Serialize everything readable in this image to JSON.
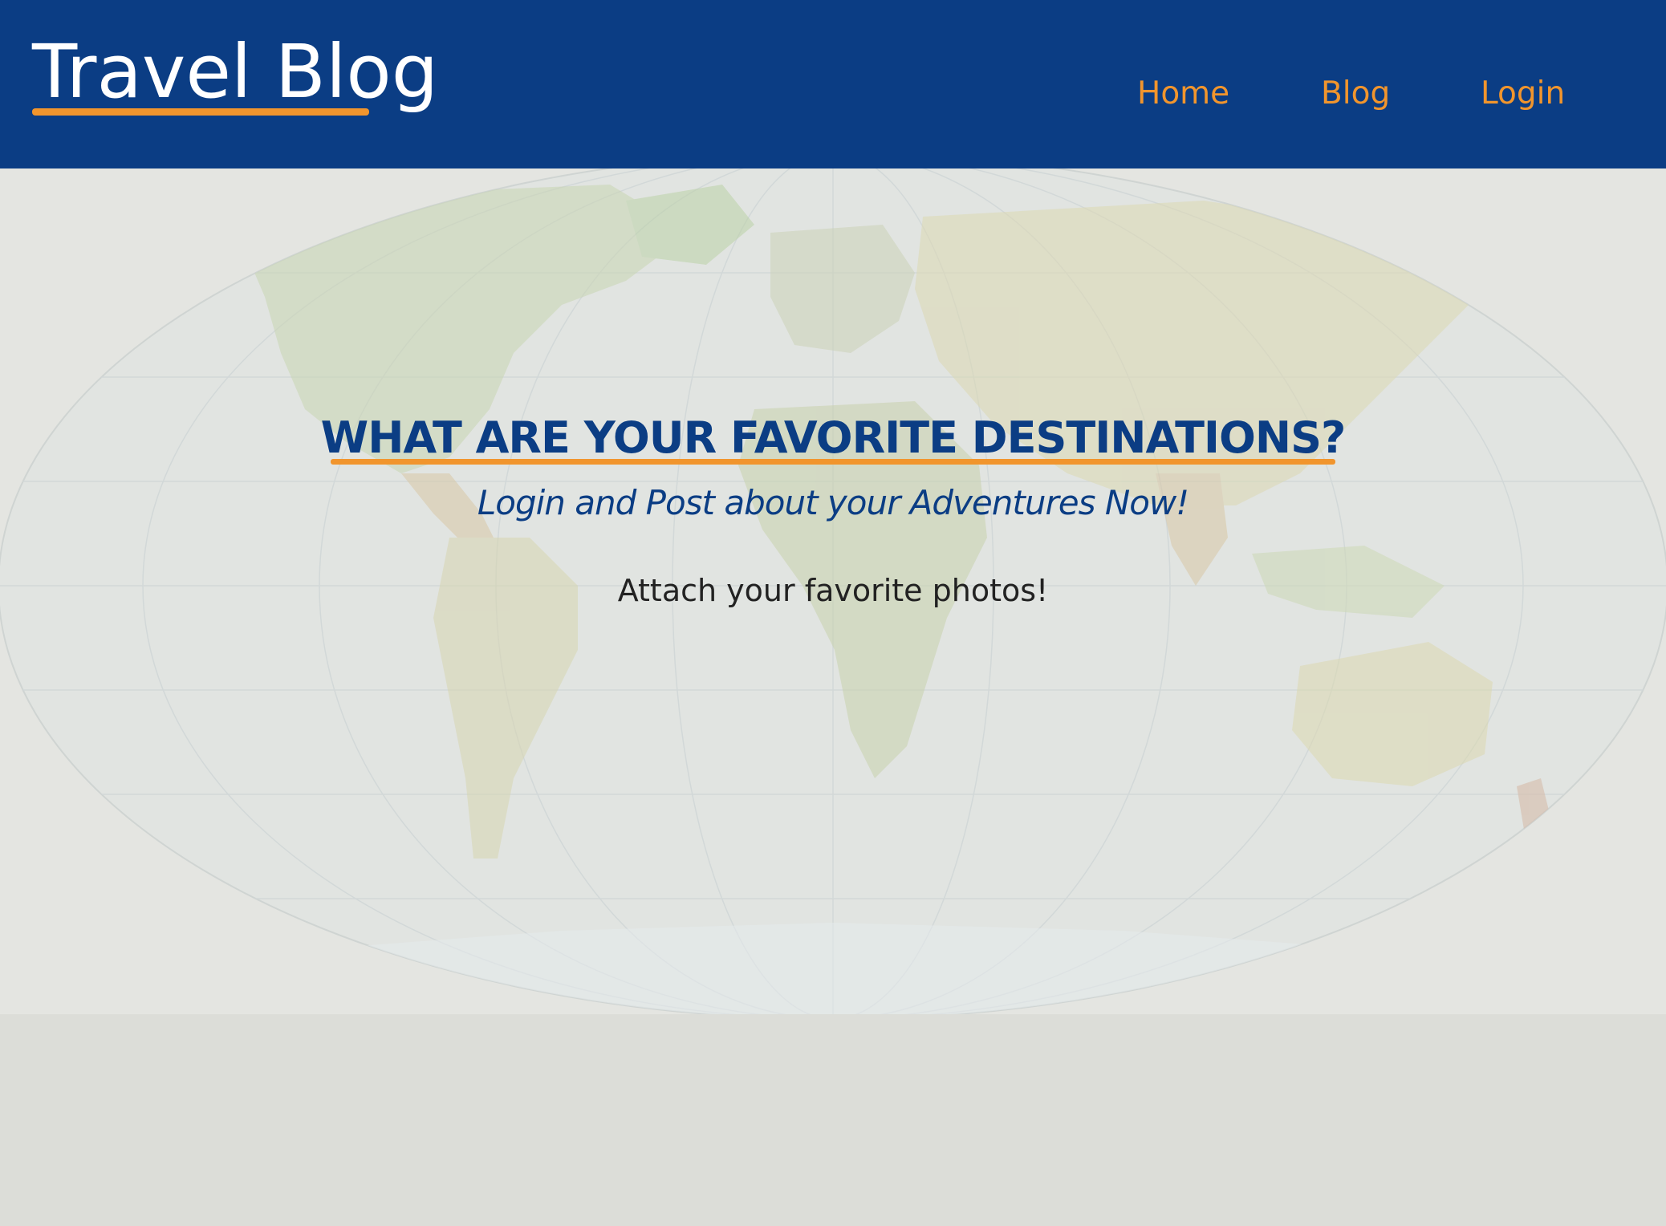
{
  "navbar": {
    "brand": "Travel Blog",
    "links": [
      {
        "label": "Home"
      },
      {
        "label": "Blog"
      },
      {
        "label": "Login"
      }
    ]
  },
  "hero": {
    "title": "WHAT ARE YOUR FAVORITE DESTINATIONS?",
    "subtitle": "Login and Post about your Adventures Now!",
    "body": "Attach your favorite photos!",
    "background_icon": "world-map"
  },
  "colors": {
    "navbar_bg": "#0b3d84",
    "accent": "#f1952d",
    "title_text": "#0b3d84",
    "body_text": "#222222"
  }
}
